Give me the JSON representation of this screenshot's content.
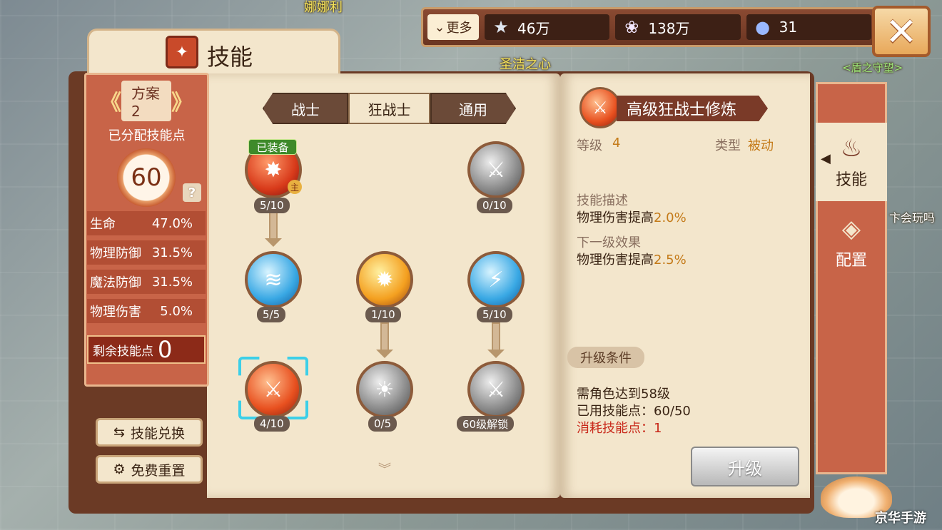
{
  "background": {
    "names": [
      "娜娜利",
      "圣洁之心",
      "<盾之守望>",
      "卞会玩吗"
    ]
  },
  "currency": {
    "more_label": "更多",
    "stars": "46万",
    "shells": "138万",
    "gems": "31",
    "close_icon": "✕"
  },
  "panel": {
    "title": "技能"
  },
  "sidebar": {
    "scheme": "方案2",
    "assigned_label": "已分配技能点",
    "assigned_points": "60",
    "help": "?",
    "stats": [
      {
        "label": "生命",
        "value": "47.0%"
      },
      {
        "label": "物理防御",
        "value": "31.5%"
      },
      {
        "label": "魔法防御",
        "value": "31.5%"
      },
      {
        "label": "物理伤害",
        "value": "5.0%"
      }
    ],
    "remaining_label": "剩余技能点",
    "remaining_value": "0",
    "exchange_button": "技能兑换",
    "reset_button": "免费重置"
  },
  "tabs": [
    "战士",
    "狂战士",
    "通用"
  ],
  "active_tab": "狂战士",
  "tree": {
    "equipped_label": "已装备",
    "main_badge": "主",
    "nodes": [
      {
        "level": "5/10"
      },
      {
        "level": "0/10"
      },
      {
        "level": "5/5"
      },
      {
        "level": "1/10"
      },
      {
        "level": "5/10"
      },
      {
        "level": "4/10"
      },
      {
        "level": "0/5"
      },
      {
        "level": "60级解锁"
      }
    ]
  },
  "detail": {
    "name": "高级狂战士修炼",
    "level_label": "等级",
    "level_value": "4",
    "type_label": "类型",
    "type_value": "被动",
    "desc_head": "技能描述",
    "desc_text": "物理伤害提高",
    "desc_value": "2.0%",
    "next_head": "下一级效果",
    "next_text": "物理伤害提高",
    "next_value": "2.5%",
    "cond_head": "升级条件",
    "cond_1": "需角色达到58级",
    "cond_2": "已用技能点：60/50",
    "cond_3": "消耗技能点：1",
    "upgrade_button": "升级"
  },
  "side_tabs": {
    "skills": "技能",
    "config": "配置"
  },
  "watermark": "京华手游",
  "colors": {
    "accent": "#c86448",
    "parchment": "#f3e6cc",
    "dark_brown": "#6b3a25",
    "highlight": "#3ccfe8"
  }
}
